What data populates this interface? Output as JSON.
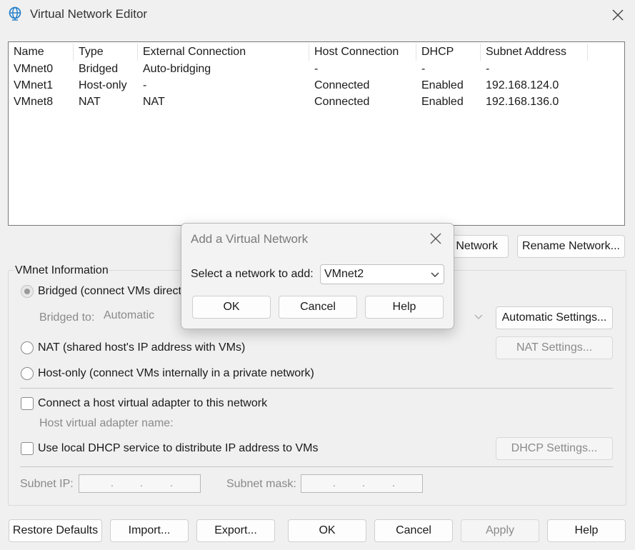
{
  "window": {
    "title": "Virtual Network Editor"
  },
  "table": {
    "headers": [
      "Name",
      "Type",
      "External Connection",
      "Host Connection",
      "DHCP",
      "Subnet Address"
    ],
    "rows": [
      [
        "VMnet0",
        "Bridged",
        "Auto-bridging",
        "-",
        "-",
        "-"
      ],
      [
        "VMnet1",
        "Host-only",
        "-",
        "Connected",
        "Enabled",
        "192.168.124.0"
      ],
      [
        "VMnet8",
        "NAT",
        "NAT",
        "Connected",
        "Enabled",
        "192.168.136.0"
      ]
    ]
  },
  "list_buttons": {
    "add_network_partial": "Network",
    "rename_network": "Rename Network..."
  },
  "vmnet_info": {
    "group_title": "VMnet Information",
    "bridged_label_partial": "Bridged (connect VMs directl",
    "bridged_to_label": "Bridged to:",
    "bridged_to_value": "Automatic",
    "automatic_settings": "Automatic Settings...",
    "nat_label": "NAT (shared host's IP address with VMs)",
    "nat_settings": "NAT Settings...",
    "hostonly_label": "Host-only (connect VMs internally in a private network)",
    "connect_adapter_label": "Connect a host virtual adapter to this network",
    "adapter_name_label": "Host virtual adapter name:",
    "dhcp_label": "Use local DHCP service to distribute IP address to VMs",
    "dhcp_settings": "DHCP Settings...",
    "subnet_ip_label": "Subnet IP:",
    "subnet_mask_label": "Subnet mask:",
    "ip_dot": "."
  },
  "bottom_buttons": {
    "restore_defaults": "Restore Defaults",
    "import": "Import...",
    "export": "Export...",
    "ok": "OK",
    "cancel": "Cancel",
    "apply": "Apply",
    "help": "Help"
  },
  "dialog": {
    "title": "Add a Virtual Network",
    "select_label": "Select a network to add:",
    "selected_value": "VMnet2",
    "ok": "OK",
    "cancel": "Cancel",
    "help": "Help"
  },
  "colors": {
    "accent_icon": "#1e7bc8",
    "background": "#f0f0f0"
  }
}
